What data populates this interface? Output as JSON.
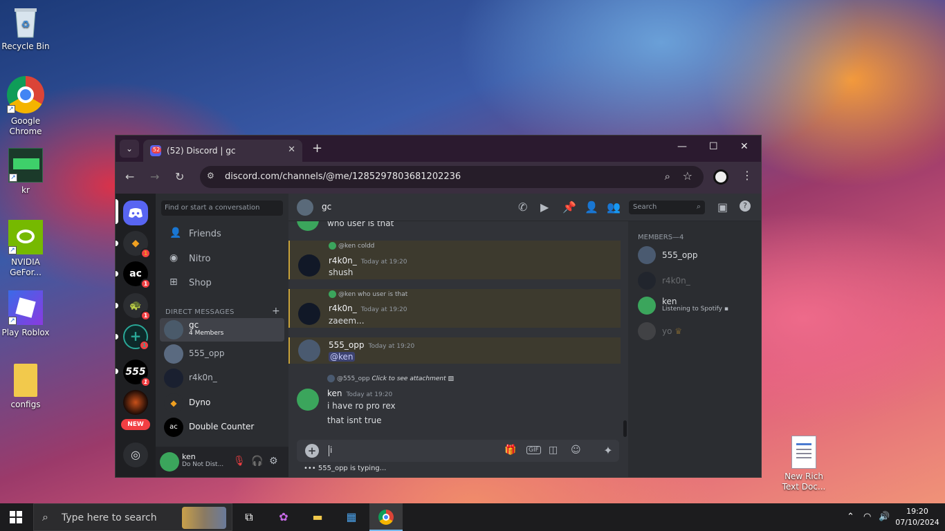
{
  "desktop": {
    "icons": [
      {
        "label": "Recycle Bin"
      },
      {
        "label": "Google Chrome"
      },
      {
        "label": "kr"
      },
      {
        "label": "NVIDIA GeFor..."
      },
      {
        "label": "Play Roblox"
      },
      {
        "label": "configs"
      },
      {
        "label": "New Rich Text Doc..."
      }
    ]
  },
  "browser": {
    "tab_title": "(52) Discord | gc",
    "tab_badge": "52",
    "url": "discord.com/channels/@me/1285297803681202236"
  },
  "discord": {
    "guild_badges": [
      "1",
      "1",
      "1",
      "1",
      "1"
    ],
    "guild_labels": {
      "double_counter": "ac",
      "s555": "555",
      "new": "NEW"
    },
    "search_placeholder": "Find or start a conversation",
    "nav": {
      "friends": "Friends",
      "nitro": "Nitro",
      "shop": "Shop"
    },
    "dm_header": "DIRECT MESSAGES",
    "dms": [
      {
        "name": "gc",
        "sub": "4 Members"
      },
      {
        "name": "555_opp"
      },
      {
        "name": "r4k0n_"
      },
      {
        "name": "Dyno"
      },
      {
        "name": "Double Counter"
      }
    ],
    "user": {
      "name": "ken",
      "status": "Do Not Dist..."
    },
    "channel": {
      "name": "gc",
      "search_placeholder": "Search"
    },
    "messages": [
      {
        "text": "who user is that"
      },
      {
        "reply": "@ken coldd",
        "author": "r4k0n_",
        "time": "Today at 19:20",
        "text": "shush"
      },
      {
        "reply": "@ken who user is that",
        "author": "r4k0n_",
        "time": "Today at 19:20",
        "text": "zaeem..."
      },
      {
        "author": "555_opp",
        "time": "Today at 19:20",
        "text": "@ken"
      },
      {
        "reply_user": "@555_opp",
        "reply_attach": "Click to see attachment",
        "author": "ken",
        "time": "Today at 19:20",
        "text": "i have ro pro rex",
        "text2": "that isnt true"
      }
    ],
    "composer": {
      "value": "i"
    },
    "typing": "555_opp is typing...",
    "members_header": "MEMBERS—4",
    "members": [
      {
        "name": "555_opp"
      },
      {
        "name": "r4k0n_"
      },
      {
        "name": "ken",
        "activity": "Listening to Spotify"
      },
      {
        "name": "yo"
      }
    ]
  },
  "taskbar": {
    "search_placeholder": "Type here to search",
    "time": "19:20",
    "date": "07/10/2024"
  }
}
